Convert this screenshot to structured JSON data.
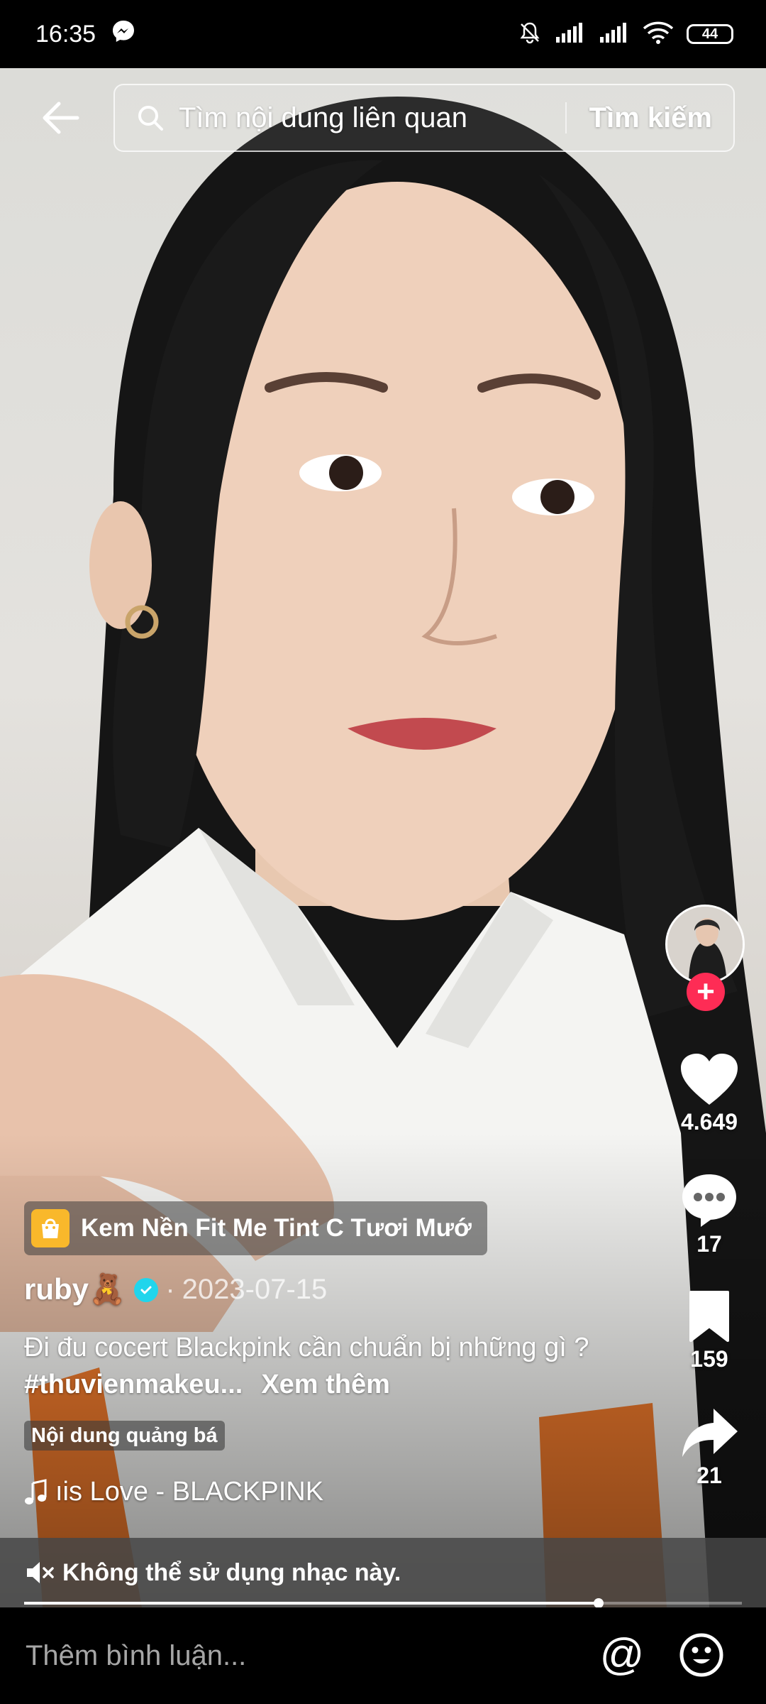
{
  "status_bar": {
    "time": "16:35",
    "battery": "44",
    "icons": [
      "messenger-icon",
      "mute-bell-icon",
      "signal-icon",
      "signal-icon",
      "wifi-icon",
      "battery-icon"
    ]
  },
  "search": {
    "placeholder": "Tìm nội dung liên quan",
    "button_label": "Tìm kiếm"
  },
  "rail": {
    "likes": "4.649",
    "comments": "17",
    "saves": "159",
    "shares": "21",
    "follow_symbol": "+"
  },
  "product": {
    "name": "Kem Nền Fit Me Tint C Tươi Mướ",
    "icon": "shopping-bag-icon"
  },
  "author": {
    "username": "ruby🧸",
    "date_separator": "·",
    "date": "2023-07-15"
  },
  "caption": {
    "text": "Đi đu cocert Blackpink cần chuẩn bị những gì ? ",
    "hashtag": "#thuvienmakeu...",
    "see_more": "Xem thêm"
  },
  "ad_label": "Nội dung quảng bá",
  "music": {
    "title": "ıis Love - BLACKPINK"
  },
  "muted_notice": "Không thể sử dụng nhạc này.",
  "progress": {
    "fraction": 0.8
  },
  "comment": {
    "placeholder": "Thêm bình luận...",
    "mention_symbol": "@"
  },
  "colors": {
    "accent_follow": "#fe2c55",
    "verified": "#20d5ec",
    "product_bag": "#f9b82b"
  }
}
